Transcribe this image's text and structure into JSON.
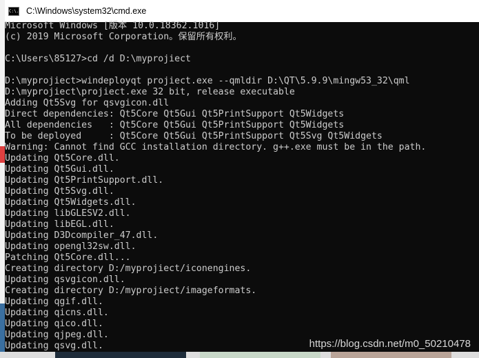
{
  "window": {
    "title": "C:\\Windows\\system32\\cmd.exe",
    "icon": "cmd-icon",
    "icon_text": "C:\\."
  },
  "console": {
    "lines": [
      "Microsoft Windows [版本 10.0.18362.1016]",
      "(c) 2019 Microsoft Corporation。保留所有权利。",
      "",
      "C:\\Users\\85127>cd /d D:\\myprojiect",
      "",
      "D:\\myprojiect>windeployqt projiect.exe --qmldir D:\\QT\\5.9.9\\mingw53_32\\qml",
      "D:\\myprojiect\\projiect.exe 32 bit, release executable",
      "Adding Qt5Svg for qsvgicon.dll",
      "Direct dependencies: Qt5Core Qt5Gui Qt5PrintSupport Qt5Widgets",
      "All dependencies   : Qt5Core Qt5Gui Qt5PrintSupport Qt5Widgets",
      "To be deployed     : Qt5Core Qt5Gui Qt5PrintSupport Qt5Svg Qt5Widgets",
      "Warning: Cannot find GCC installation directory. g++.exe must be in the path.",
      "Updating Qt5Core.dll.",
      "Updating Qt5Gui.dll.",
      "Updating Qt5PrintSupport.dll.",
      "Updating Qt5Svg.dll.",
      "Updating Qt5Widgets.dll.",
      "Updating libGLESV2.dll.",
      "Updating libEGL.dll.",
      "Updating D3Dcompiler_47.dll.",
      "Updating opengl32sw.dll.",
      "Patching Qt5Core.dll...",
      "Creating directory D:/myprojiect/iconengines.",
      "Updating qsvgicon.dll.",
      "Creating directory D:/myprojiect/imageformats.",
      "Updating qgif.dll.",
      "Updating qicns.dll.",
      "Updating qico.dll.",
      "Updating qjpeg.dll.",
      "Updating qsvg.dll."
    ]
  },
  "watermark": "https://blog.csdn.net/m0_50210478"
}
